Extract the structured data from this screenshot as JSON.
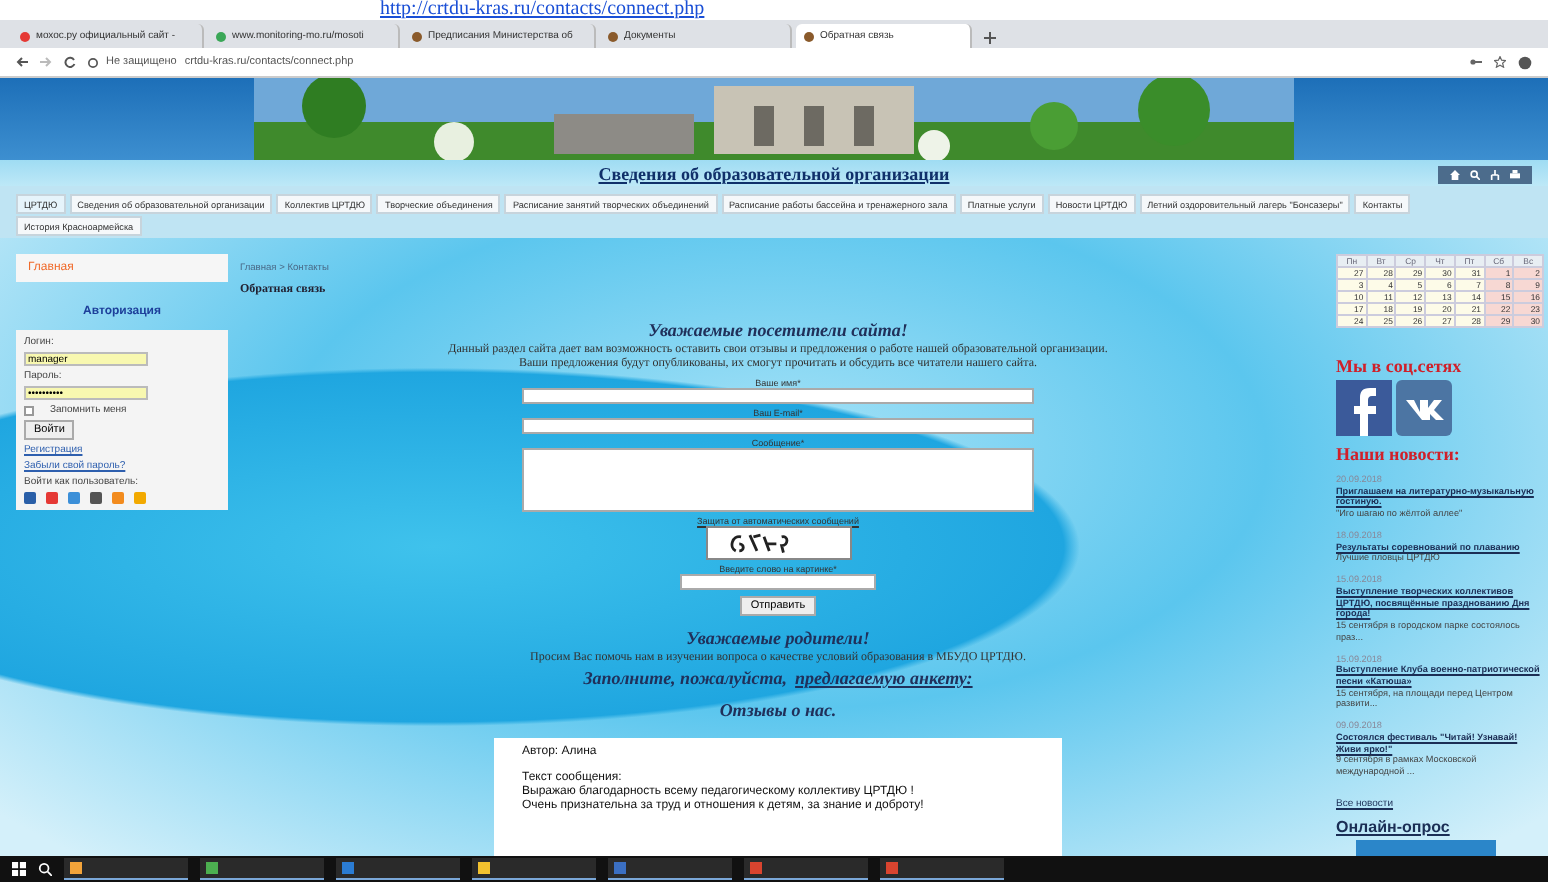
{
  "top_link": "http://crtdu-kras.ru/contacts/connect.php",
  "browser": {
    "tabs": [
      {
        "label": "мохос.ру официальный сайт -",
        "selected": false
      },
      {
        "label": "www.monitoring-mo.ru/mosoti",
        "selected": false
      },
      {
        "label": "Предписания Министерства об",
        "selected": false
      },
      {
        "label": "Документы",
        "selected": false
      },
      {
        "label": "Обратная связь",
        "selected": true
      }
    ],
    "security": "Не защищено",
    "address": "crtdu-kras.ru/contacts/connect.php"
  },
  "site_title": "Сведения об образовательной организации",
  "nav": [
    {
      "label": "ЦРТДЮ",
      "selected": true
    },
    {
      "label": "Сведения об образовательной организации",
      "selected": false
    },
    {
      "label": "Коллектив ЦРТДЮ",
      "selected": false
    },
    {
      "label": "Творческие объединения",
      "selected": false
    },
    {
      "label": "Расписание занятий творческих объединений",
      "selected": false
    },
    {
      "label": "Расписание работы бассейна и тренажерного зала",
      "selected": false
    },
    {
      "label": "Платные услуги",
      "selected": false
    },
    {
      "label": "Новости ЦРТДЮ",
      "selected": false
    },
    {
      "label": "Летний оздоровительный лагерь \"Бонсазеры\"",
      "selected": false
    },
    {
      "label": "Контакты",
      "selected": false
    },
    {
      "label": "История Красноармейска",
      "selected": false
    }
  ],
  "sidebar": {
    "home": "Главная",
    "auth_title": "Авторизация",
    "login_label": "Логин:",
    "login_value": "manager",
    "password_label": "Пароль:",
    "password_value": "••••••••••",
    "remember": {
      "label": "Запомнить меня",
      "checked": false
    },
    "login_button": "Войти",
    "links": [
      "Регистрация",
      "Забыли свой пароль?"
    ],
    "social_login": "Войти как пользователь:"
  },
  "breadcrumb": "Главная > Контакты",
  "page_title": "Обратная связь",
  "greeting": "Уважаемые посетители сайта!",
  "intro": [
    "Данный раздел сайта дает вам возможность оставить свои отзывы и предложения о работе нашей образовательной организации.",
    "Ваши предложения будут опубликованы, их смогут прочитать и обсудить все читатели нашего сайта."
  ],
  "form": {
    "name_label": "Ваше имя*",
    "email_label": "Ваш E-mail*",
    "message_label": "Сообщение*",
    "captcha_label": "Защита от автоматических сообщений",
    "captcha_input_label": "Введите слово на картинке*",
    "submit": "Отправить"
  },
  "parents_title": "Уважаемые родители!",
  "parents_text": "Просим Вас помочь нам в изучении вопроса о качестве условий образования в МБУДО ЦРТДЮ.",
  "survey_text": "Заполните, пожалуйста,",
  "survey_link": "предлагаемую анкету:",
  "reviews_title": "Отзывы о нас.",
  "review": {
    "author": "Автор: Алина",
    "text_label": "Текст сообщения:",
    "lines": [
      "Выражаю благодарность всему педагогическому коллективу ЦРТДЮ !",
      "Очень признательна за труд и отношения к детям, за знание и доброту!"
    ]
  },
  "calendar": {
    "days": [
      "Пн",
      "Вт",
      "Ср",
      "Чт",
      "Пт",
      "Сб",
      "Вс"
    ],
    "weeks": [
      [
        "27",
        "28",
        "29",
        "30",
        "31",
        "1",
        "2"
      ],
      [
        "3",
        "4",
        "5",
        "6",
        "7",
        "8",
        "9"
      ],
      [
        "10",
        "11",
        "12",
        "13",
        "14",
        "15",
        "16"
      ],
      [
        "17",
        "18",
        "19",
        "20",
        "21",
        "22",
        "23"
      ],
      [
        "24",
        "25",
        "26",
        "27",
        "28",
        "29",
        "30"
      ]
    ]
  },
  "social_title": "Мы в соц.сетях",
  "news_title": "Наши новости:",
  "news": [
    {
      "date": "20.09.2018",
      "title": "Приглашаем на литературно-музыкальную гостиную.",
      "snippet": "\"Иго шагаю по жёлтой аллее\""
    },
    {
      "date": "18.09.2018",
      "title": "Результаты соревнований по плаванию",
      "snippet": "Лучшие пловцы ЦРТДЮ"
    },
    {
      "date": "15.09.2018",
      "title": "Выступление творческих коллективов ЦРТДЮ, посвящённые празднованию Дня города!",
      "snippet": "15 сентября в городском парке состоялось праз..."
    },
    {
      "date": "15.09.2018",
      "title": "Выступление Клуба военно-патриотической песни «Катюша»",
      "snippet": "15 сентября, на площади перед Центром развити..."
    },
    {
      "date": "09.09.2018",
      "title": "Состоялся фестиваль \"Читай! Узнавай! Живи ярко!\"",
      "snippet": "9 сентября в рамках Московской международной ..."
    }
  ],
  "all_news": "Все новости",
  "poll_title": "Онлайн-опрос",
  "taskbar": [
    {
      "kind": "app",
      "color": "#f2a33a"
    },
    {
      "kind": "app",
      "color": "#4caf50"
    },
    {
      "kind": "app",
      "color": "#2b7cd3"
    },
    {
      "kind": "app",
      "color": "#f2c12e"
    },
    {
      "kind": "app",
      "color": "#3b6fc2"
    },
    {
      "kind": "app",
      "color": "#d9442f"
    },
    {
      "kind": "app",
      "color": "#d9442f"
    }
  ]
}
